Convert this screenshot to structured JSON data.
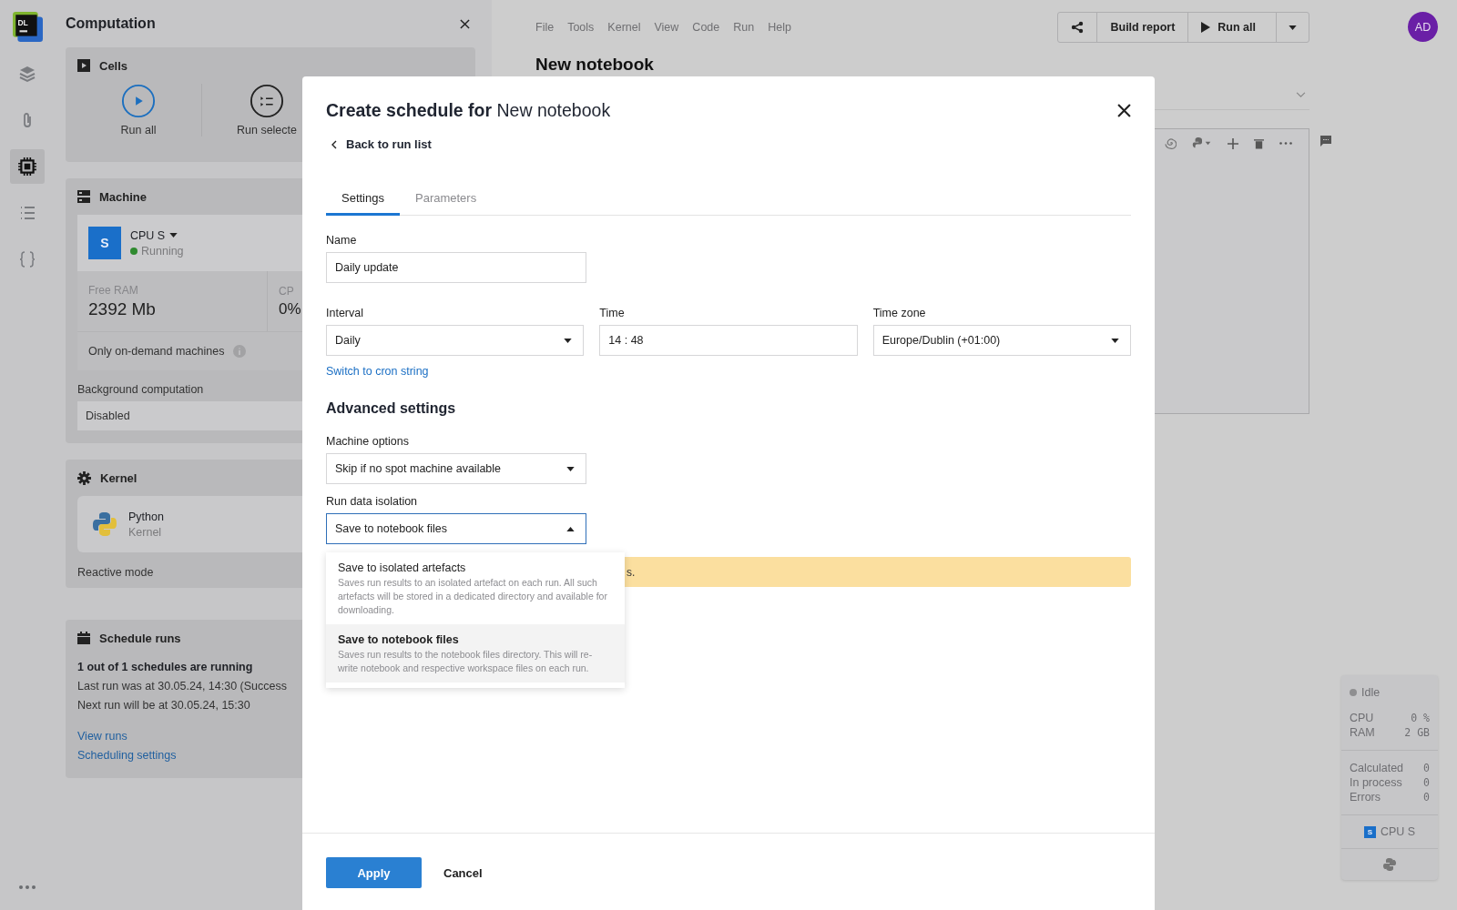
{
  "rail": {
    "logo_text": "DL",
    "items": [
      {
        "kind": "layers",
        "selected": false
      },
      {
        "kind": "clip",
        "selected": false
      },
      {
        "kind": "chip",
        "selected": true
      },
      {
        "kind": "list",
        "selected": false
      },
      {
        "kind": "braces",
        "selected": false
      }
    ]
  },
  "panel": {
    "title": "Computation",
    "cells": {
      "title": "Cells",
      "actions": [
        {
          "kind": "run-all",
          "label": "Run all"
        },
        {
          "kind": "run-selected",
          "label": "Run selecte"
        }
      ]
    },
    "machine": {
      "title": "Machine",
      "badge": "S",
      "name": "CPU S",
      "status": "Running",
      "stats": [
        {
          "label": "Free RAM",
          "value": "2392 Mb"
        },
        {
          "label": "CP",
          "value": "0%"
        }
      ],
      "on_demand": "Only on-demand machines",
      "background_label": "Background computation",
      "background_value": "Disabled"
    },
    "kernel": {
      "title": "Kernel",
      "name": "Python",
      "sub": "Kernel",
      "mode": "Reactive mode"
    },
    "schedule": {
      "title": "Schedule runs",
      "summary": "1 out of 1 schedules are running",
      "last": "Last run was at 30.05.24, 14:30 (Success",
      "next": "Next run will be at 30.05.24, 15:30",
      "links": [
        "View runs",
        "Scheduling settings"
      ]
    }
  },
  "menu": [
    "File",
    "Tools",
    "Kernel",
    "View",
    "Code",
    "Run",
    "Help"
  ],
  "notebook_title": "New notebook",
  "toolbar": {
    "build_report": "Build report",
    "run_all": "Run all"
  },
  "avatar": "AD",
  "modal": {
    "title_bold": "Create schedule for",
    "title_rest": "New notebook",
    "back": "Back to run list",
    "tabs": [
      {
        "label": "Settings",
        "selected": true
      },
      {
        "label": "Parameters",
        "selected": false
      }
    ],
    "name": {
      "label": "Name",
      "value": "Daily update"
    },
    "interval": {
      "label": "Interval",
      "value": "Daily"
    },
    "time": {
      "label": "Time",
      "value": "14 : 48"
    },
    "timezone": {
      "label": "Time zone",
      "value": "Europe/Dublin (+01:00)"
    },
    "cron_link": "Switch to cron string",
    "advanced_title": "Advanced settings",
    "machine_options": {
      "label": "Machine options",
      "value": "Skip if no spot machine available"
    },
    "isolation": {
      "label": "Run data isolation",
      "value": "Save to notebook files",
      "expanded": true,
      "options": [
        {
          "title": "Save to isolated artefacts",
          "description": "Saves run results to an isolated artefact on each run. All such artefacts will be stored in a dedicated directory and available for downloading.",
          "selected": false
        },
        {
          "title": "Save to notebook files",
          "description": "Saves run results to the notebook files directory. This will re-write notebook and respective workspace files on each run.",
          "selected": true
        }
      ]
    },
    "warning": "s.",
    "apply": "Apply",
    "cancel": "Cancel"
  },
  "status_panel": {
    "state": "Idle",
    "metrics": [
      {
        "label": "CPU",
        "value": "0 %"
      },
      {
        "label": "RAM",
        "value": "2 GB"
      }
    ],
    "counts": [
      {
        "label": "Calculated",
        "value": "0"
      },
      {
        "label": "In process",
        "value": "0"
      },
      {
        "label": "Errors",
        "value": "0"
      }
    ],
    "badge": "S",
    "machine": "CPU S"
  }
}
